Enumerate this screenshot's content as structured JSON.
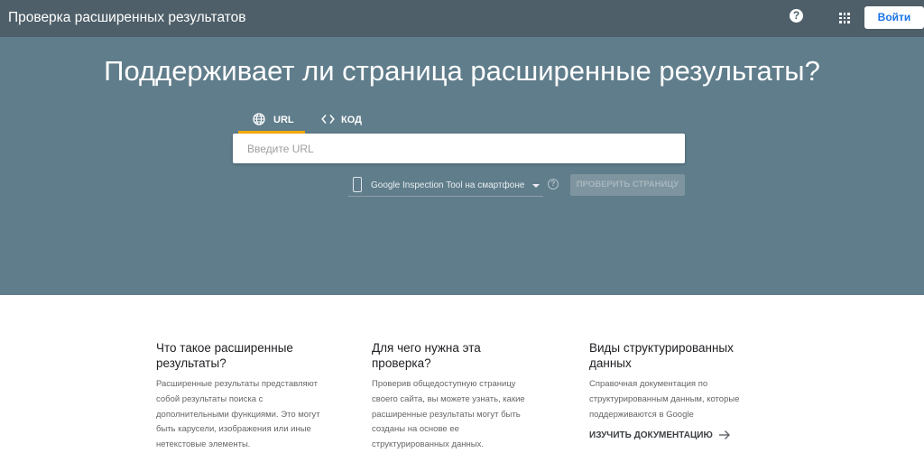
{
  "app": {
    "title": "Проверка расширенных результатов",
    "login_label": "Войти",
    "help_glyph": "?"
  },
  "hero": {
    "title": "Поддерживает ли страница расширенные результаты?",
    "tabs": [
      {
        "label": "URL",
        "icon": "globe-icon",
        "active": true
      },
      {
        "label": "КОД",
        "icon": "code-icon",
        "active": false
      }
    ],
    "url_input": {
      "placeholder": "Введите URL",
      "value": ""
    },
    "device_select": {
      "selected": "Google Inspection Tool на смартфоне"
    },
    "check_button": "ПРОВЕРИТЬ СТРАНИЦУ",
    "help_glyph": "?"
  },
  "info": [
    {
      "title_line1": "Что такое расширенные",
      "title_line2": "результаты?",
      "text": [
        "Расширенные результаты представляют",
        "собой результаты поиска с",
        "дополнительными функциями. Это могут",
        "быть карусели, изображения или иные",
        "нетекстовые элементы."
      ]
    },
    {
      "title_line1": "Для чего нужна эта",
      "title_line2": "проверка?",
      "text": [
        "Проверив общедоступную страницу",
        "своего сайта, вы можете узнать, какие",
        "расширенные результаты могут быть",
        "созданы на основе ее",
        "структурированных данных."
      ]
    },
    {
      "title_line1": "Виды структурированных",
      "title_line2": "данных",
      "text": [
        "Справочная документация по",
        "структурированным данным, которые",
        "поддерживаются в Google"
      ],
      "link": "ИЗУЧИТЬ ДОКУМЕНТАЦИЮ"
    }
  ],
  "colors": {
    "topbar": "#4e5f69",
    "hero": "#607d8b",
    "accent": "#f9ab00",
    "link_blue": "#1a73e8"
  }
}
